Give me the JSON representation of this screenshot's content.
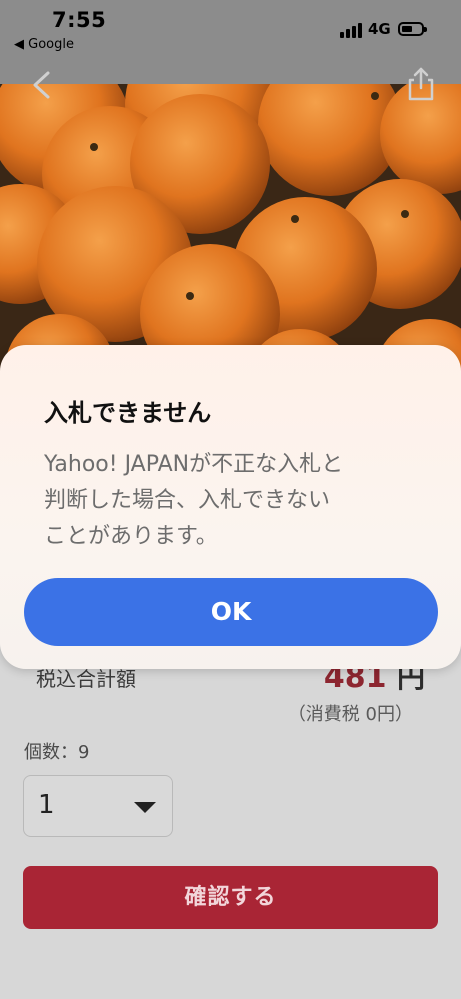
{
  "status_bar": {
    "time": "7:55",
    "back_app": "◀ Google",
    "network": "4G"
  },
  "product": {
    "image_subject": "oranges"
  },
  "summary": {
    "total_label": "税込合計額",
    "price": "481",
    "currency": "円",
    "tax_note": "（消費税 0円）"
  },
  "quantity": {
    "label": "個数：9",
    "selected": "1"
  },
  "confirm_label": "確認する",
  "alert": {
    "title": "入札できません",
    "message": "Yahoo! JAPANが不正な入札と\n判断した場合、入札できない\nことがあります。",
    "ok_label": "OK"
  },
  "colors": {
    "ok_button": "#3b72e6",
    "confirm_button": "#a92535",
    "price": "#8d2630"
  }
}
